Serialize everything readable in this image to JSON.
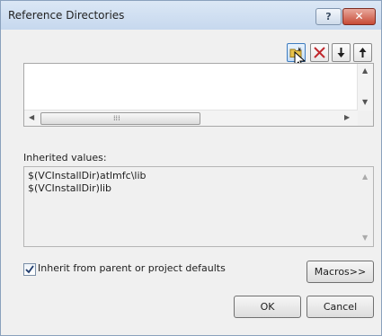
{
  "window": {
    "title": "Reference Directories"
  },
  "titlebar": {
    "help_label": "?",
    "close_label": "✕"
  },
  "toolbar": {
    "buttons": [
      {
        "name": "new-line",
        "icon": "folder-new-icon"
      },
      {
        "name": "delete",
        "icon": "delete-x-icon"
      },
      {
        "name": "move-down",
        "icon": "arrow-down-icon"
      },
      {
        "name": "move-up",
        "icon": "arrow-up-icon"
      }
    ]
  },
  "directories": {
    "entries": [],
    "scroll_grip": "⁞⁞⁞"
  },
  "inherited": {
    "label": "Inherited values:",
    "values": [
      "$(VCInstallDir)atlmfc\\lib",
      "$(VCInstallDir)lib"
    ]
  },
  "inherit_checkbox": {
    "label": "Inherit from parent or project defaults",
    "checked": true
  },
  "buttons": {
    "macros": "Macros>>",
    "ok": "OK",
    "cancel": "Cancel"
  },
  "colors": {
    "titlebar": "#c6d8ee",
    "close": "#c74b36",
    "delete_icon": "#c0282d",
    "folder_icon": "#e8c24a"
  }
}
